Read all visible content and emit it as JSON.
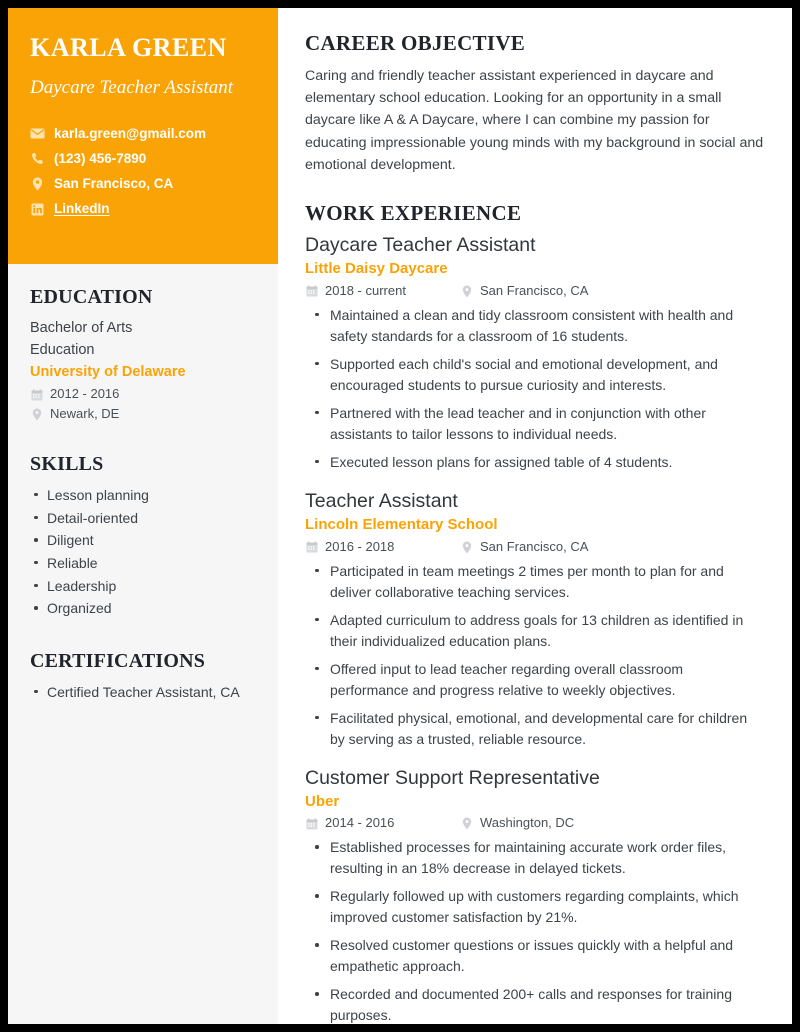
{
  "theme": {
    "accent": "#faa307",
    "sidebar_bg": "#f6f6f6",
    "page_bg": "#ffffff",
    "border": "#000000",
    "heading_color": "#21252b",
    "body_text": "#3d4349"
  },
  "sidebar": {
    "name": "KARLA GREEN",
    "job_title": "Daycare Teacher Assistant",
    "contacts": [
      {
        "icon": "envelope-icon",
        "text": "karla.green@gmail.com",
        "is_link": false
      },
      {
        "icon": "phone-icon",
        "text": "(123) 456-7890",
        "is_link": false
      },
      {
        "icon": "map-pin-icon",
        "text": "San Francisco, CA",
        "is_link": false
      },
      {
        "icon": "linkedin-icon",
        "text": "LinkedIn",
        "is_link": true
      }
    ],
    "education": {
      "heading": "EDUCATION",
      "degree": "Bachelor of Arts",
      "field": "Education",
      "school": "University of Delaware",
      "dates": "2012 - 2016",
      "location": "Newark, DE"
    },
    "skills": {
      "heading": "SKILLS",
      "items": [
        "Lesson planning",
        "Detail-oriented",
        "Diligent",
        "Reliable",
        "Leadership",
        "Organized"
      ]
    },
    "certifications": {
      "heading": "CERTIFICATIONS",
      "items": [
        "Certified Teacher Assistant, CA"
      ]
    }
  },
  "main": {
    "objective": {
      "heading": "CAREER OBJECTIVE",
      "text": "Caring and friendly teacher assistant experienced in daycare and elementary school education. Looking for an opportunity in a small daycare like A & A Daycare, where I can combine my passion for educating impressionable young minds with my background in social and emotional development."
    },
    "work": {
      "heading": "WORK EXPERIENCE",
      "jobs": [
        {
          "title": "Daycare Teacher Assistant",
          "company": "Little Daisy Daycare",
          "dates": "2018 - current",
          "location": "San Francisco, CA",
          "bullets": [
            "Maintained a clean and tidy classroom consistent with health and safety standards for a classroom of 16 students.",
            "Supported each child's social and emotional development, and encouraged students to pursue curiosity and interests.",
            "Partnered with the lead teacher and in conjunction with other assistants to tailor lessons to individual needs.",
            "Executed lesson plans for assigned table of 4 students."
          ]
        },
        {
          "title": "Teacher Assistant",
          "company": "Lincoln Elementary School",
          "dates": "2016 - 2018",
          "location": "San Francisco, CA",
          "bullets": [
            "Participated in team meetings 2 times per month to plan for and deliver collaborative teaching services.",
            "Adapted curriculum to address goals for 13 children as identified in their individualized education plans.",
            "Offered input to lead teacher regarding overall classroom performance and progress relative to weekly objectives.",
            "Facilitated physical, emotional, and developmental care for children by serving as a trusted, reliable resource."
          ]
        },
        {
          "title": "Customer Support Representative",
          "company": "Uber",
          "dates": "2014 - 2016",
          "location": "Washington, DC",
          "bullets": [
            "Established processes for maintaining accurate work order files, resulting in an 18% decrease in delayed tickets.",
            "Regularly followed up with customers regarding complaints, which improved customer satisfaction by 21%.",
            "Resolved customer questions or issues quickly with a helpful and empathetic approach.",
            "Recorded and documented 200+ calls and responses for training purposes."
          ]
        }
      ]
    }
  }
}
